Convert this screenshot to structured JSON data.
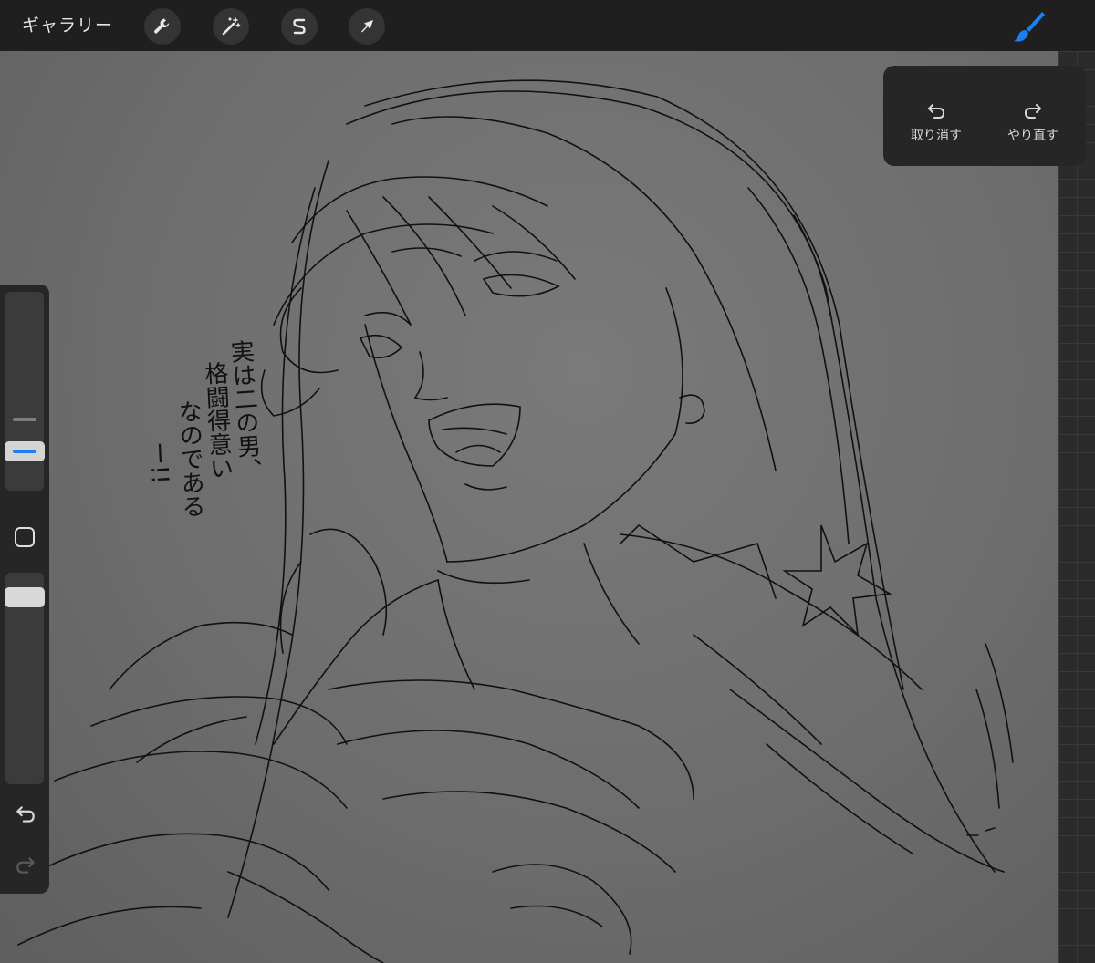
{
  "topbar": {
    "gallery_label": "ギャラリー",
    "tools": [
      {
        "name": "actions",
        "icon": "wrench-icon"
      },
      {
        "name": "adjustments",
        "icon": "magic-wand-icon"
      },
      {
        "name": "selection",
        "icon": "selection-s-icon"
      },
      {
        "name": "transform",
        "icon": "arrow-cursor-icon"
      }
    ],
    "active_tool": {
      "name": "brush",
      "icon": "brush-icon",
      "color": "#1a7ff0"
    }
  },
  "history_panel": {
    "undo_label": "取り消す",
    "redo_label": "やり直す",
    "undo_icon": "undo-arrow-icon",
    "redo_icon": "redo-arrow-icon"
  },
  "sidebar": {
    "brush_size_level": 0.2,
    "opacity_level": 0.93,
    "modify_icon": "square-icon",
    "undo_icon": "undo-arrow-icon",
    "redo_icon": "redo-arrow-icon",
    "accent_color": "#1a7ff0"
  },
  "canvas": {
    "background_color": "#6e6e6e",
    "handwritten_text": [
      "実は二の男、",
      "格闘得意い",
      "なのである",
      "ー!!"
    ]
  }
}
